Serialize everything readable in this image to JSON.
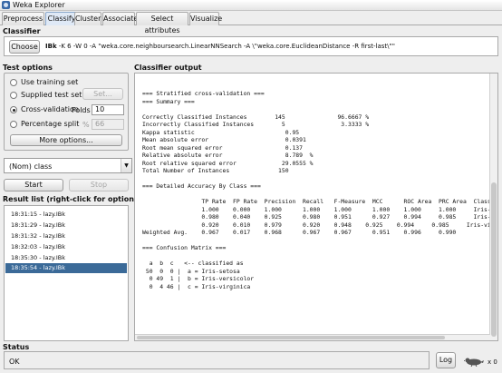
{
  "window": {
    "title": "Weka Explorer"
  },
  "tabs": [
    {
      "label": "Preprocess"
    },
    {
      "label": "Classify"
    },
    {
      "label": "Cluster"
    },
    {
      "label": "Associate"
    },
    {
      "label": "Select attributes"
    },
    {
      "label": "Visualize"
    }
  ],
  "classifier": {
    "section_title": "Classifier",
    "choose_label": "Choose",
    "name": "IBk",
    "options": " -K 6 -W 0 -A \"weka.core.neighboursearch.LinearNNSearch -A \\\"weka.core.EuclideanDistance -R first-last\\\"\""
  },
  "test_options": {
    "section_title": "Test options",
    "use_training_set": "Use training set",
    "supplied_test_set": "Supplied test set",
    "set_label": "Set...",
    "cross_validation": "Cross-validation",
    "folds_label": "Folds",
    "folds_value": "10",
    "percentage_split": "Percentage split",
    "percent_symbol": "%",
    "percent_value": "66",
    "more_options_label": "More options...",
    "selected": "cross_validation"
  },
  "class_select": {
    "value": "(Nom) class",
    "arrow_icon": "chevron-down-icon"
  },
  "actions": {
    "start_label": "Start",
    "stop_label": "Stop"
  },
  "result_list": {
    "section_title": "Result list (right-click for options)",
    "items": [
      "18:31:15 - lazy.IBk",
      "18:31:29 - lazy.IBk",
      "18:31:32 - lazy.IBk",
      "18:32:03 - lazy.IBk",
      "18:35:30 - lazy.IBk",
      "18:35:54 - lazy.IBk"
    ],
    "selected_index": 5
  },
  "output": {
    "section_title": "Classifier output",
    "text": "=== Stratified cross-validation ===\n=== Summary ===\n\nCorrectly Classified Instances        145               96.6667 %\nIncorrectly Classified Instances        5                3.3333 %\nKappa statistic                          0.95\nMean absolute error                      0.0391\nRoot mean squared error                  0.137\nRelative absolute error                  8.789  %\nRoot relative squared error             29.0555 %\nTotal Number of Instances              150\n\n=== Detailed Accuracy By Class ===\n\n                 TP Rate  FP Rate  Precision  Recall   F-Measure  MCC      ROC Area  PRC Area  Class\n                 1.000    0.000    1.000      1.000    1.000      1.000    1.000     1.000     Iris-setosa\n                 0.980    0.040    0.925      0.980    0.951      0.927    0.994     0.985     Iris-versicolor\n                 0.920    0.010    0.979      0.920    0.948    0.925    0.994     0.985     Iris-virginica\nWeighted Avg.    0.967    0.017    0.968      0.967    0.967      0.951    0.996     0.990\n\n=== Confusion Matrix ===\n\n  a  b  c   <-- classified as\n 50  0  0 |  a = Iris-setosa\n  0 49  1 |  b = Iris-versicolor\n  0  4 46 |  c = Iris-virginica"
  },
  "status": {
    "section_title": "Status",
    "text": "OK",
    "log_label": "Log",
    "bird_icon": "weka-bird-icon",
    "count_label": "x 0"
  }
}
